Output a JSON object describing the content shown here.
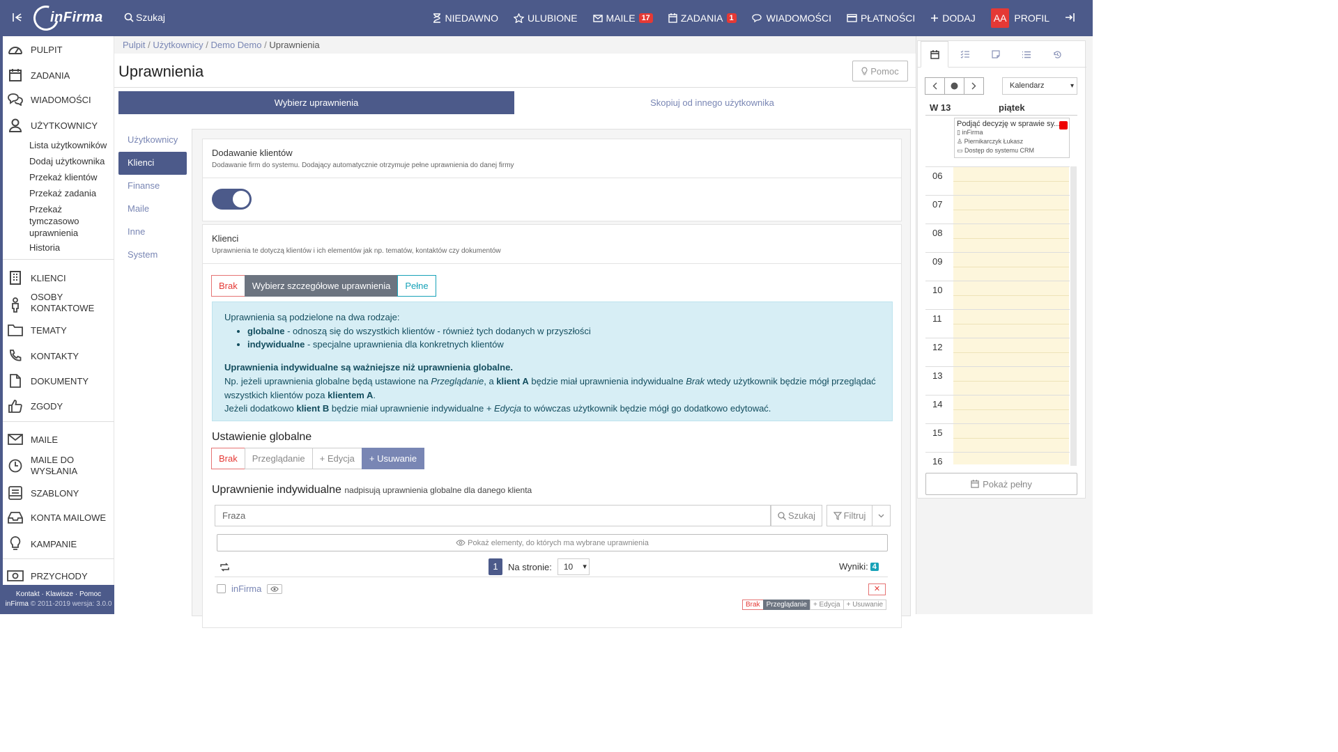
{
  "topbar": {
    "logo_text": "inFirma",
    "search_label": "Szukaj",
    "nav": [
      {
        "label": "NIEDAWNO",
        "icon": "hourglass-icon"
      },
      {
        "label": "ULUBIONE",
        "icon": "star-icon"
      },
      {
        "label": "MAILE",
        "icon": "mail-icon",
        "badge": "17"
      },
      {
        "label": "ZADANIA",
        "icon": "calendar-icon",
        "badge": "1"
      },
      {
        "label": "WIADOMOŚCI",
        "icon": "chat-icon"
      },
      {
        "label": "PŁATNOŚCI",
        "icon": "card-icon"
      },
      {
        "label": "DODAJ",
        "icon": "plus-icon"
      }
    ],
    "profile_initials": "AA",
    "profile_label": "PROFIL"
  },
  "sidebar": {
    "items": [
      {
        "label": "PULPIT",
        "icon": "dashboard-icon"
      },
      {
        "label": "ZADANIA",
        "icon": "calendar-icon"
      },
      {
        "label": "WIADOMOŚCI",
        "icon": "chat-icon"
      },
      {
        "label": "UŻYTKOWNICY",
        "icon": "user-icon"
      }
    ],
    "users_sub": [
      "Lista użytkowników",
      "Dodaj użytkownika",
      "Przekaż klientów",
      "Przekaż zadania",
      "Przekaż tymczasowo uprawnienia",
      "Historia"
    ],
    "items2": [
      {
        "label": "KLIENCI",
        "icon": "building-icon"
      },
      {
        "label": "OSOBY KONTAKTOWE",
        "icon": "person-icon"
      },
      {
        "label": "TEMATY",
        "icon": "folder-icon"
      },
      {
        "label": "KONTAKTY",
        "icon": "phone-icon"
      },
      {
        "label": "DOKUMENTY",
        "icon": "document-icon"
      },
      {
        "label": "ZGODY",
        "icon": "thumbs-up-icon"
      }
    ],
    "items3": [
      {
        "label": "MAILE",
        "icon": "mail-icon"
      },
      {
        "label": "MAILE DO WYSŁANIA",
        "icon": "clock-icon"
      },
      {
        "label": "SZABLONY",
        "icon": "template-icon"
      },
      {
        "label": "KONTA MAILOWE",
        "icon": "inbox-icon"
      },
      {
        "label": "KAMPANIE",
        "icon": "bulb-icon"
      }
    ],
    "items4": [
      {
        "label": "PRZYCHODY",
        "icon": "money-icon"
      }
    ],
    "footer_links": "Kontakt · Klawisze · Pomoc",
    "footer_brand": "inFirma",
    "footer_copy": "© 2011-2019 wersja: 3.0.0"
  },
  "breadcrumb": [
    "Pulpit",
    "Użytkownicy",
    "Demo Demo",
    "Uprawnienia"
  ],
  "page": {
    "title": "Uprawnienia",
    "help_label": "Pomoc",
    "tab_selected": "Wybierz uprawnienia",
    "tab_other": "Skopiuj od innego użytkownika",
    "left_nav": [
      "Użytkownicy",
      "Klienci",
      "Finanse",
      "Maile",
      "Inne",
      "System"
    ]
  },
  "card_add": {
    "title": "Dodawanie klientów",
    "desc": "Dodawanie firm do systemu. Dodający automatycznie otrzymuje pełne uprawnienia do danej firmy",
    "toggle_on": true
  },
  "card_clients": {
    "title": "Klienci",
    "desc": "Uprawnienia te dotyczą klientów i ich elementów jak np. tematów, kontaktów czy dokumentów",
    "mode_buttons": [
      "Brak",
      "Wybierz szczegółowe uprawnienia",
      "Pełne"
    ],
    "info": {
      "intro": "Uprawnienia są podzielone na dwa rodzaje:",
      "b1_bold": "globalne",
      "b1_text": " - odnoszą się do wszystkich klientów - również tych dodanych w przyszłości",
      "b2_bold": "indywidualne",
      "b2_text": " - specjalne uprawnienia dla konkretnych klientów",
      "strong": "Uprawnienia indywidualne są ważniejsze niż uprawnienia globalne.",
      "l1a": "Np. jeżeli uprawnienia globalne będą ustawione na ",
      "l1b": "Przeglądanie",
      "l1c": ", a ",
      "l1d": "klient A",
      "l1e": " będzie miał uprawnienia indywidualne ",
      "l1f": "Brak",
      "l1g": " wtedy użytkownik będzie mógł przeglądać wszystkich klientów poza ",
      "l1h": "klientem A",
      "l1i": ".",
      "l2a": "Jeżeli dodatkowo ",
      "l2b": "klient B",
      "l2c": " będzie miał uprawnienie indywidualne ",
      "l2d": "+ Edycja",
      "l2e": " to wówczas użytkownik będzie mógł go dodatkowo edytować."
    },
    "global_title": "Ustawienie globalne",
    "global_buttons": [
      "Brak",
      "Przeglądanie",
      "+ Edycja",
      "+ Usuwanie"
    ],
    "indiv_title": "Uprawnienie indywidualne",
    "indiv_sub": "nadpisują uprawnienia globalne dla danego klienta",
    "search_placeholder": "Fraza",
    "search_btn": "Szukaj",
    "filter_btn": "Filtruj",
    "show_elements": "Pokaż elementy, do których ma wybrane uprawnienia",
    "page_num": "1",
    "per_page_label": "Na stronie:",
    "per_page": "10",
    "results_label": "Wyniki:",
    "results_count": "4",
    "row_name": "inFirma",
    "row_perms": [
      "Brak",
      "Przeglądanie",
      "+ Edycja",
      "+ Usuwanie"
    ]
  },
  "calendar": {
    "view_select": "Kalendarz",
    "week": "W 13",
    "day": "piątek",
    "event": {
      "title": "Podjąć decyzję w sprawie sy...",
      "company": "inFirma",
      "person": "Piernikarczyk Łukasz",
      "topic": "Dostęp do systemu CRM"
    },
    "hours": [
      "06",
      "07",
      "08",
      "09",
      "10",
      "11",
      "12",
      "13",
      "14",
      "15",
      "16"
    ],
    "show_full": "Pokaż pełny"
  }
}
